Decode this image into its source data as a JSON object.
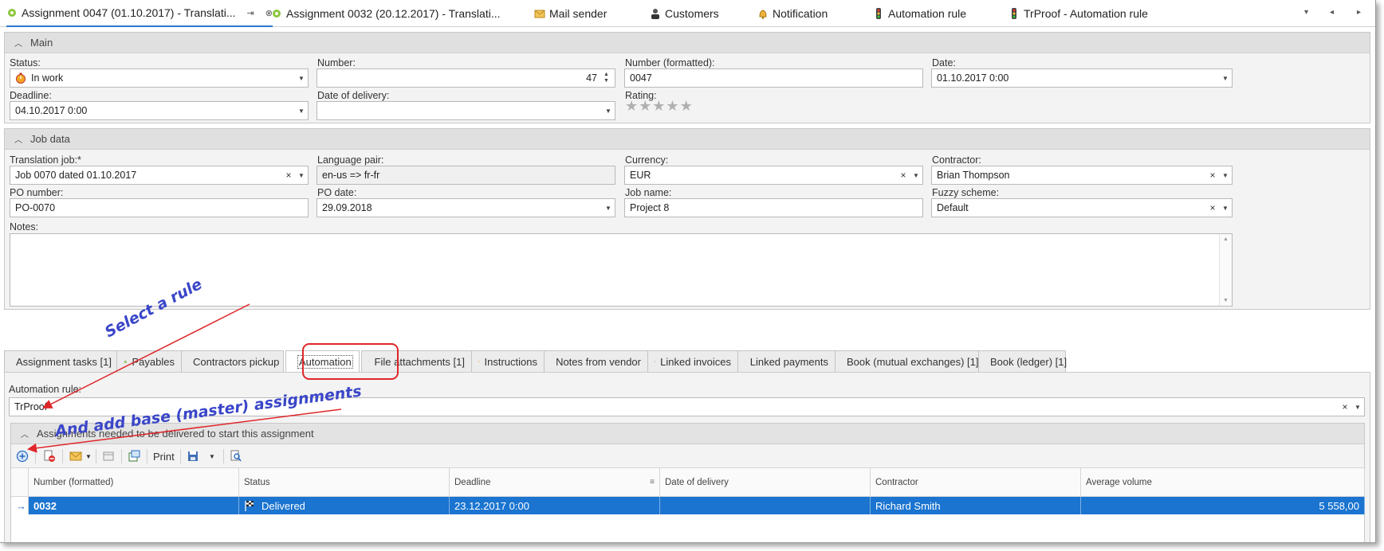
{
  "doc_tabs": [
    {
      "label": "Assignment 0047 (01.10.2017) - Translati..."
    },
    {
      "label": "Assignment 0032 (20.12.2017) - Translati..."
    },
    {
      "label": "Mail sender"
    },
    {
      "label": "Customers"
    },
    {
      "label": "Notification"
    },
    {
      "label": "Automation rule"
    },
    {
      "label": "TrProof - Automation rule"
    }
  ],
  "main": {
    "header": "Main",
    "status_label": "Status:",
    "status_value": "In work",
    "number_label": "Number:",
    "number_value": "47",
    "number_formatted_label": "Number (formatted):",
    "number_formatted_value": "0047",
    "date_label": "Date:",
    "date_value": "01.10.2017 0:00",
    "deadline_label": "Deadline:",
    "deadline_value": "04.10.2017 0:00",
    "delivery_label": "Date of delivery:",
    "delivery_value": "",
    "rating_label": "Rating:",
    "rating_value": 0,
    "rating_max": 5
  },
  "job": {
    "header": "Job data",
    "translation_job_label": "Translation job:*",
    "translation_job_value": "Job 0070 dated 01.10.2017",
    "language_pair_label": "Language pair:",
    "language_pair_value": "en-us => fr-fr",
    "currency_label": "Currency:",
    "currency_value": "EUR",
    "contractor_label": "Contractor:",
    "contractor_value": "Brian Thompson",
    "po_number_label": "PO number:",
    "po_number_value": "PO-0070",
    "po_date_label": "PO date:",
    "po_date_value": "29.09.2018",
    "job_name_label": "Job name:",
    "job_name_value": "Project 8",
    "fuzzy_label": "Fuzzy scheme:",
    "fuzzy_value": "Default",
    "notes_label": "Notes:",
    "notes_value": ""
  },
  "lower_tabs": [
    {
      "label": "Assignment tasks [1]"
    },
    {
      "label": "Payables"
    },
    {
      "label": "Contractors pickup"
    },
    {
      "label": "Automation"
    },
    {
      "label": "File attachments [1]"
    },
    {
      "label": "Instructions"
    },
    {
      "label": "Notes from vendor"
    },
    {
      "label": "Linked invoices"
    },
    {
      "label": "Linked payments"
    },
    {
      "label": "Book (mutual exchanges) [1]"
    },
    {
      "label": "Book (ledger) [1]"
    }
  ],
  "automation": {
    "rule_label": "Automation rule:",
    "rule_value": "TrProof",
    "group_header": "Assignments needed to be delivered to start this assignment",
    "print_label": "Print",
    "columns": [
      "Number (formatted)",
      "Status",
      "Deadline",
      "Date of delivery",
      "Contractor",
      "Average volume"
    ],
    "rows": [
      {
        "number": "0032",
        "status": "Delivered",
        "deadline": "23.12.2017 0:00",
        "delivery": "",
        "contractor": "Richard Smith",
        "volume": "5 558,00"
      }
    ]
  },
  "annotations": {
    "select_rule": "Select a rule",
    "add_base": "And add base (master) assignments"
  },
  "colors": {
    "accent": "#2b78d0",
    "selection": "#1a74d0",
    "annotation": "#3a46c8",
    "highlight": "#e0262a"
  }
}
